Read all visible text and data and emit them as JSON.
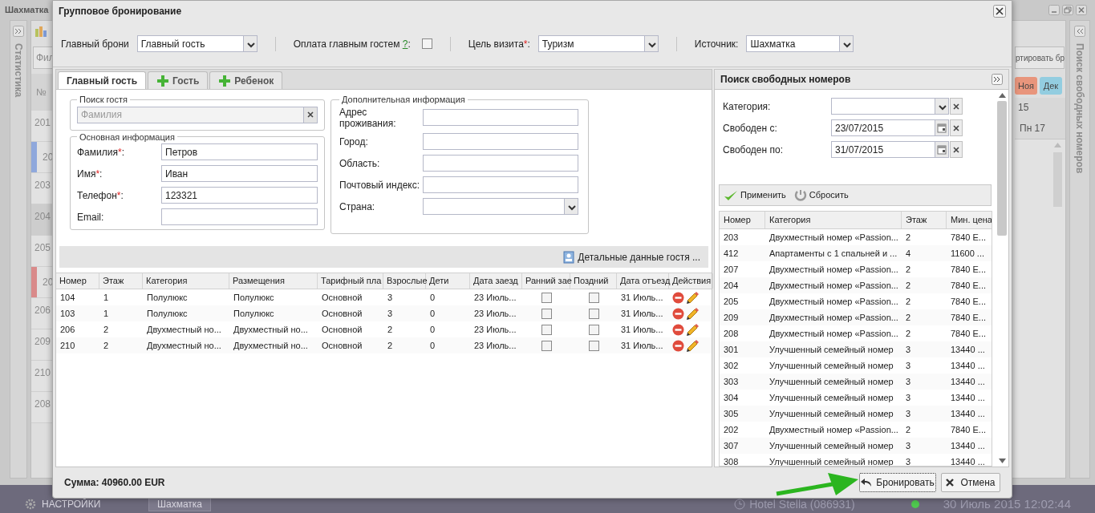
{
  "app": {
    "title": "Шахматка",
    "left_panel": "Статистика",
    "filter_stub": "Фил",
    "room_column": "№",
    "rooms": [
      {
        "number": "201",
        "selected": false
      },
      {
        "number": "20",
        "selected": false,
        "color": "#8fa8dc"
      },
      {
        "number": "203",
        "selected": false
      },
      {
        "number": "204",
        "selected": true
      },
      {
        "number": "205",
        "selected": false
      },
      {
        "number": "20",
        "selected": false,
        "color": "#d98a8a"
      },
      {
        "number": "206",
        "selected": false
      },
      {
        "number": "209",
        "selected": false
      },
      {
        "number": "210",
        "selected": false
      },
      {
        "number": "208",
        "selected": false
      }
    ],
    "export_stub": "ртировать бр",
    "months": [
      {
        "label": "Ноя",
        "color": "#e8957c"
      },
      {
        "label": "Дек",
        "color": "#93cde0"
      }
    ],
    "year_stub": "15",
    "day": "Пн 17",
    "right_panel": "Поиск свободных номеров"
  },
  "taskbar": {
    "settings": "НАСТРОЙКИ",
    "window_tab": "Шахматка",
    "hotel": "Hotel Stella (086931)",
    "online": true,
    "datetime": "30 Июль 2015 12:02:44"
  },
  "dialog": {
    "title": "Групповое бронирование",
    "top_fields": [
      {
        "kind": "select",
        "label": "Главный брони",
        "value": "Главный гость"
      },
      {
        "kind": "checkbox",
        "label": "Оплата главным гостем ",
        "help": "?",
        "label_end": ":",
        "checked": false
      },
      {
        "kind": "select",
        "label": "Цель визита",
        "required": "*",
        "label_end": ":",
        "value": "Туризм"
      },
      {
        "kind": "select",
        "label": "Источник:",
        "value": "Шахматка"
      }
    ],
    "tabs": [
      {
        "label": "Главный гость",
        "kind": "plain",
        "selected": true
      },
      {
        "label": "Гость",
        "kind": "add",
        "selected": false
      },
      {
        "label": "Ребенок",
        "kind": "add",
        "selected": false
      }
    ],
    "guest_search": {
      "legend": "Поиск гостя",
      "placeholder": "Фамилия"
    },
    "basic_info": {
      "legend": "Основная информация",
      "fields": [
        {
          "label": "Фамилия",
          "required": "*",
          "label_end": ":",
          "value": "Петров"
        },
        {
          "label": "Имя",
          "required": "*",
          "label_end": ":",
          "value": "Иван"
        },
        {
          "label": "Телефон",
          "required": "*",
          "label_end": ":",
          "value": "123321"
        },
        {
          "label": "Email:"
        }
      ]
    },
    "extra_info": {
      "legend": "Дополнительная информация",
      "fields": [
        {
          "kind": "text",
          "label": "Адрес проживания:"
        },
        {
          "kind": "text",
          "label": "Город:"
        },
        {
          "kind": "text",
          "label": "Область:"
        },
        {
          "kind": "text",
          "label": "Почтовый индекс:"
        },
        {
          "kind": "select",
          "label": "Страна:"
        }
      ]
    },
    "details_button": "Детальные данные гостя ...",
    "rooms": {
      "columns": [
        "Номер",
        "Этаж",
        "Категория",
        "Размещения",
        "Тарифный пла",
        "Взрослые",
        "Дети",
        "Дата заезд",
        "Ранний зае",
        "Поздний",
        "Дата отъезд",
        "Действия"
      ],
      "rows": [
        {
          "number": "104",
          "floor": "1",
          "category": "Полулюкс",
          "placement": "Полулюкс",
          "rate": "Основной",
          "adults": "3",
          "children": "0",
          "arrival": "23 Июль...",
          "early": false,
          "late": false,
          "departure": "31 Июль..."
        },
        {
          "number": "103",
          "floor": "1",
          "category": "Полулюкс",
          "placement": "Полулюкс",
          "rate": "Основной",
          "adults": "3",
          "children": "0",
          "arrival": "23 Июль...",
          "early": false,
          "late": false,
          "departure": "31 Июль..."
        },
        {
          "number": "206",
          "floor": "2",
          "category": "Двухместный но...",
          "placement": "Двухместный но...",
          "rate": "Основной",
          "adults": "2",
          "children": "0",
          "arrival": "23 Июль...",
          "early": false,
          "late": false,
          "departure": "31 Июль..."
        },
        {
          "number": "210",
          "floor": "2",
          "category": "Двухместный но...",
          "placement": "Двухместный но...",
          "rate": "Основной",
          "adults": "2",
          "children": "0",
          "arrival": "23 Июль...",
          "early": false,
          "late": false,
          "departure": "31 Июль..."
        }
      ]
    },
    "search_panel": {
      "title": "Поиск свободных номеров",
      "fields": [
        {
          "kind": "select",
          "label": "Категория:"
        },
        {
          "kind": "date",
          "label": "Свободен с:",
          "value": "23/07/2015"
        },
        {
          "kind": "date",
          "label": "Свободен по:",
          "value": "31/07/2015"
        }
      ],
      "apply": "Применить",
      "reset": "Сбросить",
      "columns": [
        "Номер",
        "Категория",
        "Этаж",
        "Мин. цена"
      ],
      "rows": [
        [
          "203",
          "Двухместный номер «Passion...",
          "2",
          "7840 E..."
        ],
        [
          "412",
          "Апартаменты с 1 спальней и ...",
          "4",
          "11600 ..."
        ],
        [
          "207",
          "Двухместный номер «Passion...",
          "2",
          "7840 E..."
        ],
        [
          "204",
          "Двухместный номер «Passion...",
          "2",
          "7840 E..."
        ],
        [
          "205",
          "Двухместный номер «Passion...",
          "2",
          "7840 E..."
        ],
        [
          "209",
          "Двухместный номер «Passion...",
          "2",
          "7840 E..."
        ],
        [
          "208",
          "Двухместный номер «Passion...",
          "2",
          "7840 E..."
        ],
        [
          "301",
          "Улучшенный семейный номер",
          "3",
          "13440 ..."
        ],
        [
          "302",
          "Улучшенный семейный номер",
          "3",
          "13440 ..."
        ],
        [
          "303",
          "Улучшенный семейный номер",
          "3",
          "13440 ..."
        ],
        [
          "304",
          "Улучшенный семейный номер",
          "3",
          "13440 ..."
        ],
        [
          "305",
          "Улучшенный семейный номер",
          "3",
          "13440 ..."
        ],
        [
          "202",
          "Двухместный номер «Passion...",
          "2",
          "7840 E..."
        ],
        [
          "307",
          "Улучшенный семейный номер",
          "3",
          "13440 ..."
        ],
        [
          "308",
          "Улучшенный семейный номер",
          "3",
          "13440 ..."
        ]
      ]
    },
    "total": "Сумма: 40960.00 EUR",
    "book_button": "Бронировать",
    "cancel_button": "Отмена"
  }
}
